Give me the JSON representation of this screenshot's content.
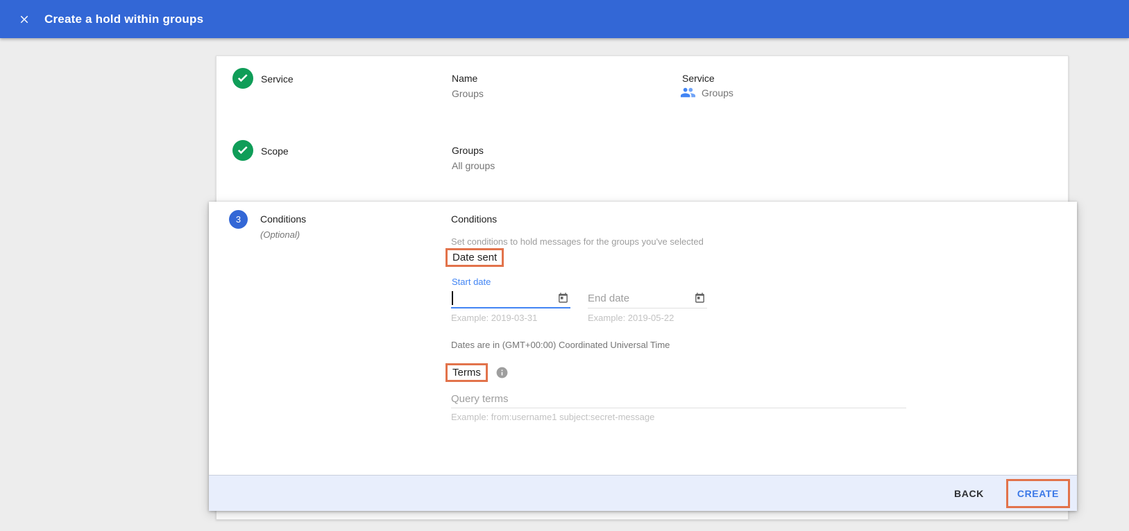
{
  "window": {
    "title": "Create a hold within groups"
  },
  "steps": {
    "service": {
      "label": "Service",
      "status": "complete",
      "name_label": "Name",
      "name_value": "Groups",
      "service_label": "Service",
      "service_value": "Groups",
      "service_icon": "groups-people-icon"
    },
    "scope": {
      "label": "Scope",
      "status": "complete",
      "groups_label": "Groups",
      "groups_value": "All groups"
    },
    "conditions": {
      "number": "3",
      "label": "Conditions",
      "optional": "(Optional)",
      "status": "active"
    }
  },
  "conditions_panel": {
    "heading": "Conditions",
    "description": "Set conditions to hold messages for the groups you've selected",
    "date_sent_label": "Date sent",
    "start_date": {
      "label": "Start date",
      "value": "",
      "example": "Example: 2019-03-31"
    },
    "end_date": {
      "placeholder": "End date",
      "example": "Example: 2019-05-22"
    },
    "timezone_note": "Dates are in (GMT+00:00) Coordinated Universal Time",
    "terms_label": "Terms",
    "query": {
      "placeholder": "Query terms",
      "example": "Example: from:username1 subject:secret-message"
    }
  },
  "footer": {
    "back_label": "BACK",
    "create_label": "CREATE"
  },
  "colors": {
    "header_bg": "#3367d6",
    "accent_blue": "#4285f4",
    "success_green": "#0f9d58",
    "annotation_orange": "#e2734b",
    "footer_bg": "#e8eefc",
    "create_text": "#3b78e7"
  }
}
